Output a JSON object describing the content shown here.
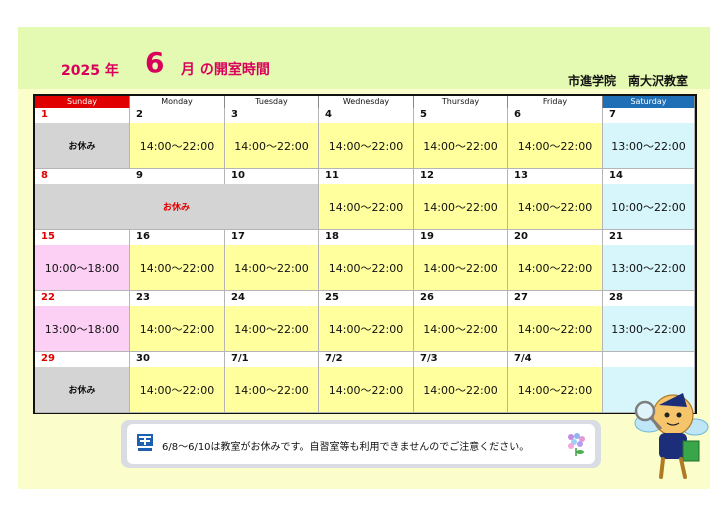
{
  "title": {
    "year": "2025 年",
    "month": "6",
    "suffix": "月 の開室時間"
  },
  "org": "市進学院　南大沢教室",
  "weekdays": [
    "Sunday",
    "Monday",
    "Tuesday",
    "Wednesday",
    "Thursday",
    "Friday",
    "Saturday"
  ],
  "closed_label": "お休み",
  "weeks": [
    [
      {
        "day": "1",
        "text": "お休み",
        "style": "closed"
      },
      {
        "day": "2",
        "text": "14:00～22:00"
      },
      {
        "day": "3",
        "text": "14:00～22:00"
      },
      {
        "day": "4",
        "text": "14:00～22:00"
      },
      {
        "day": "5",
        "text": "14:00～22:00"
      },
      {
        "day": "6",
        "text": "14:00～22:00"
      },
      {
        "day": "7",
        "text": "13:00～22:00"
      }
    ],
    [
      {
        "day": "8",
        "text": "お休み",
        "style": "closed-span"
      },
      {
        "day": "9",
        "text": ""
      },
      {
        "day": "10",
        "text": ""
      },
      {
        "day": "11",
        "text": "14:00～22:00"
      },
      {
        "day": "12",
        "text": "14:00～22:00"
      },
      {
        "day": "13",
        "text": "14:00～22:00"
      },
      {
        "day": "14",
        "text": "10:00～22:00"
      }
    ],
    [
      {
        "day": "15",
        "text": "10:00～18:00"
      },
      {
        "day": "16",
        "text": "14:00～22:00"
      },
      {
        "day": "17",
        "text": "14:00～22:00"
      },
      {
        "day": "18",
        "text": "14:00～22:00"
      },
      {
        "day": "19",
        "text": "14:00～22:00"
      },
      {
        "day": "20",
        "text": "14:00～22:00"
      },
      {
        "day": "21",
        "text": "13:00～22:00"
      }
    ],
    [
      {
        "day": "22",
        "text": "13:00～18:00"
      },
      {
        "day": "23",
        "text": "14:00～22:00"
      },
      {
        "day": "24",
        "text": "14:00～22:00"
      },
      {
        "day": "25",
        "text": "14:00～22:00"
      },
      {
        "day": "26",
        "text": "14:00～22:00"
      },
      {
        "day": "27",
        "text": "14:00～22:00"
      },
      {
        "day": "28",
        "text": "13:00～22:00"
      }
    ],
    [
      {
        "day": "29",
        "text": "お休み",
        "style": "closed"
      },
      {
        "day": "30",
        "text": "14:00～22:00"
      },
      {
        "day": "7/1",
        "text": "14:00～22:00"
      },
      {
        "day": "7/2",
        "text": "14:00～22:00"
      },
      {
        "day": "7/3",
        "text": "14:00～22:00"
      },
      {
        "day": "7/4",
        "text": "14:00～22:00"
      },
      {
        "day": "",
        "text": ""
      }
    ]
  ],
  "notice": "6/8～6/10は教室がお休みです。自習室等も利用できませんのでご注意ください。",
  "colors": {
    "weekday_open": "#ffff9e",
    "saturday": "#d6f6fb",
    "sunday_open": "#fccff5",
    "closed": "#d4d4d4",
    "accent": "#d8005a",
    "sunday_header": "#e00000",
    "saturday_header": "#1f6fb6"
  },
  "icons": {
    "logo": "school-logo-icon",
    "flower": "hydrangea-icon",
    "mascot": "mascot-magnifier-icon"
  }
}
